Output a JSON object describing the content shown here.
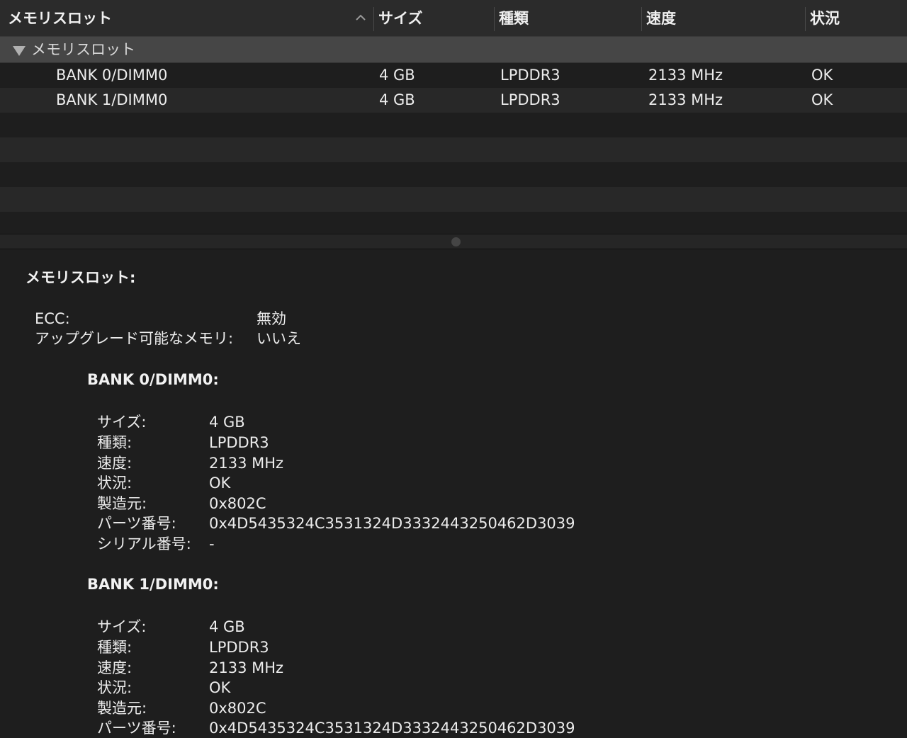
{
  "table": {
    "columns": [
      {
        "label": "メモリスロット"
      },
      {
        "label": "サイズ"
      },
      {
        "label": "種類"
      },
      {
        "label": "速度"
      },
      {
        "label": "状況"
      }
    ],
    "sort_icon": "chevron-up-icon",
    "group": {
      "disclosure_icon": "disclosure-triangle-down-icon",
      "label": "メモリスロット",
      "rows": [
        {
          "slot": "BANK 0/DIMM0",
          "size": "4 GB",
          "type": "LPDDR3",
          "speed": "2133 MHz",
          "status": "OK"
        },
        {
          "slot": "BANK 1/DIMM0",
          "size": "4 GB",
          "type": "LPDDR3",
          "speed": "2133 MHz",
          "status": "OK"
        }
      ]
    }
  },
  "detail": {
    "title": "メモリスロット:",
    "ecc_label": "ECC:",
    "ecc_value": "無効",
    "upgradeable_label": "アップグレード可能なメモリ:",
    "upgradeable_value": "いいえ",
    "banks": [
      {
        "title": "BANK 0/DIMM0:",
        "size_label": "サイズ:",
        "size": "4 GB",
        "type_label": "種類:",
        "type": "LPDDR3",
        "speed_label": "速度:",
        "speed": "2133 MHz",
        "status_label": "状況:",
        "status": "OK",
        "manufacturer_label": "製造元:",
        "manufacturer": "0x802C",
        "part_label": "パーツ番号:",
        "part": "0x4D5435324C3531324D3332443250462D3039",
        "serial_label": "シリアル番号:",
        "serial": "-"
      },
      {
        "title": "BANK 1/DIMM0:",
        "size_label": "サイズ:",
        "size": "4 GB",
        "type_label": "種類:",
        "type": "LPDDR3",
        "speed_label": "速度:",
        "speed": "2133 MHz",
        "status_label": "状況:",
        "status": "OK",
        "manufacturer_label": "製造元:",
        "manufacturer": "0x802C",
        "part_label": "パーツ番号:",
        "part": "0x4D5435324C3531324D3332443250462D3039"
      }
    ]
  }
}
